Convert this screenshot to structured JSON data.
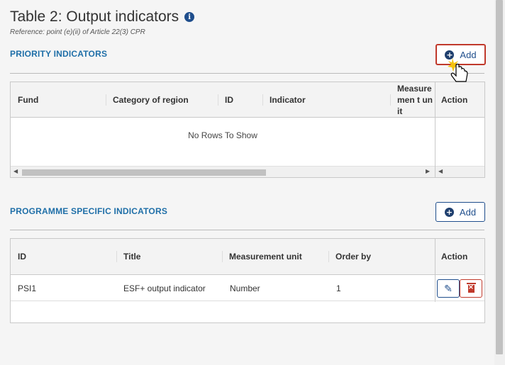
{
  "header": {
    "title": "Table 2: Output indicators",
    "info_icon": "i",
    "reference": "Reference: point (e)(ii) of Article 22(3) CPR"
  },
  "priority": {
    "section_title": "PRIORITY INDICATORS",
    "add_label": "Add",
    "columns": [
      "Fund",
      "Category of region",
      "ID",
      "Indicator",
      "Measuremen t unit",
      "Action"
    ],
    "empty_message": "No Rows To Show"
  },
  "programme": {
    "section_title": "PROGRAMME SPECIFIC INDICATORS",
    "add_label": "Add",
    "columns": [
      "ID",
      "Title",
      "Measurement unit",
      "Order by",
      "Action"
    ],
    "rows": [
      {
        "id": "PSI1",
        "title": "ESF+ output indicator",
        "unit": "Number",
        "order": "1"
      }
    ]
  },
  "colors": {
    "accent": "#1f4e8c",
    "section": "#1f6fa8",
    "danger": "#c0392b"
  }
}
